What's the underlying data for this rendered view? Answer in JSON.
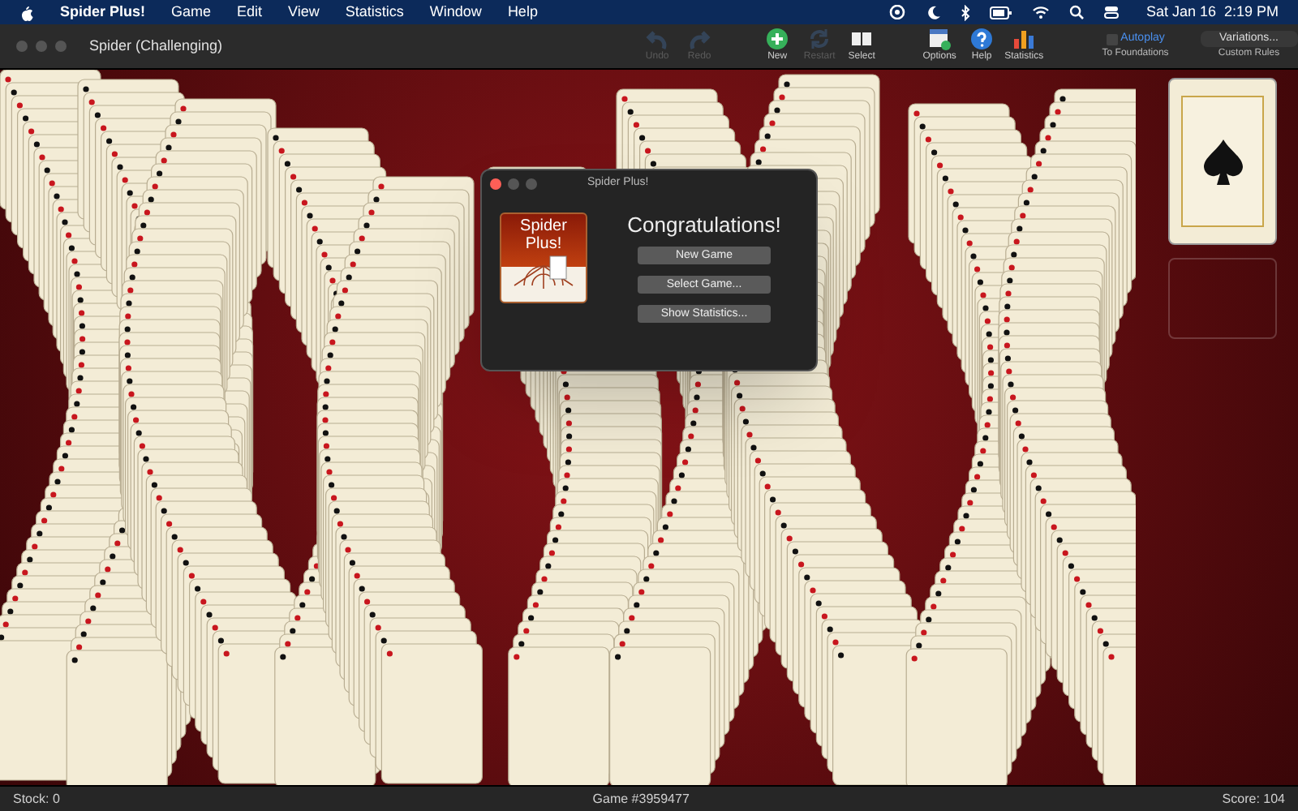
{
  "menu_bar": {
    "app_name": "Spider Plus!",
    "menus": [
      "Game",
      "Edit",
      "View",
      "Statistics",
      "Window",
      "Help"
    ],
    "clock": "Sat Jan 16  2:19 PM"
  },
  "window": {
    "title": "Spider (Challenging)"
  },
  "toolbar": [
    {
      "kind": "undo",
      "label": "Undo",
      "disabled": true
    },
    {
      "kind": "redo",
      "label": "Redo",
      "disabled": true
    },
    {
      "kind": "new",
      "label": "New",
      "disabled": false
    },
    {
      "kind": "restart",
      "label": "Restart",
      "disabled": true
    },
    {
      "kind": "select",
      "label": "Select",
      "disabled": false
    },
    {
      "kind": "options",
      "label": "Options",
      "disabled": false
    },
    {
      "kind": "help",
      "label": "Help",
      "disabled": false
    },
    {
      "kind": "statistics",
      "label": "Statistics",
      "disabled": false
    }
  ],
  "autoplay": {
    "label": "Autoplay",
    "caption": "To Foundations",
    "checked": false
  },
  "variations": {
    "label": "Variations...",
    "caption": "Custom Rules"
  },
  "dialog": {
    "title": "Spider Plus!",
    "logo_text": [
      "Spider",
      "Plus!"
    ],
    "heading": "Congratulations!",
    "buttons": [
      "New Game",
      "Select Game...",
      "Show Statistics..."
    ]
  },
  "status_bar": {
    "stock": "Stock: 0",
    "game": "Game #3959477",
    "score": "Score: 104"
  }
}
